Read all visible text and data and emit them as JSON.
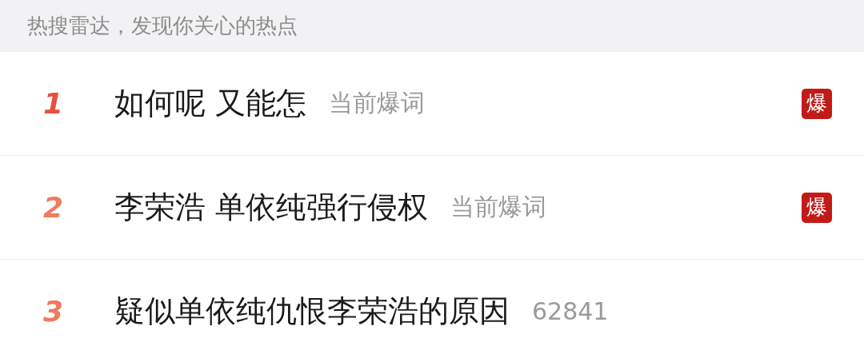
{
  "header": {
    "text": "热搜雷达，发现你关心的热点"
  },
  "items": [
    {
      "rank": "1",
      "color": "#e8503c",
      "title": "如何呢 又能怎",
      "note": "当前爆词",
      "badge": "爆"
    },
    {
      "rank": "2",
      "color": "#f07a5e",
      "title": "李荣浩 单依纯强行侵权",
      "note": "当前爆词",
      "badge": "爆"
    },
    {
      "rank": "3",
      "color": "#f07a5e",
      "title": "疑似单依纯仇恨李荣浩的原因",
      "note": "62841"
    }
  ]
}
